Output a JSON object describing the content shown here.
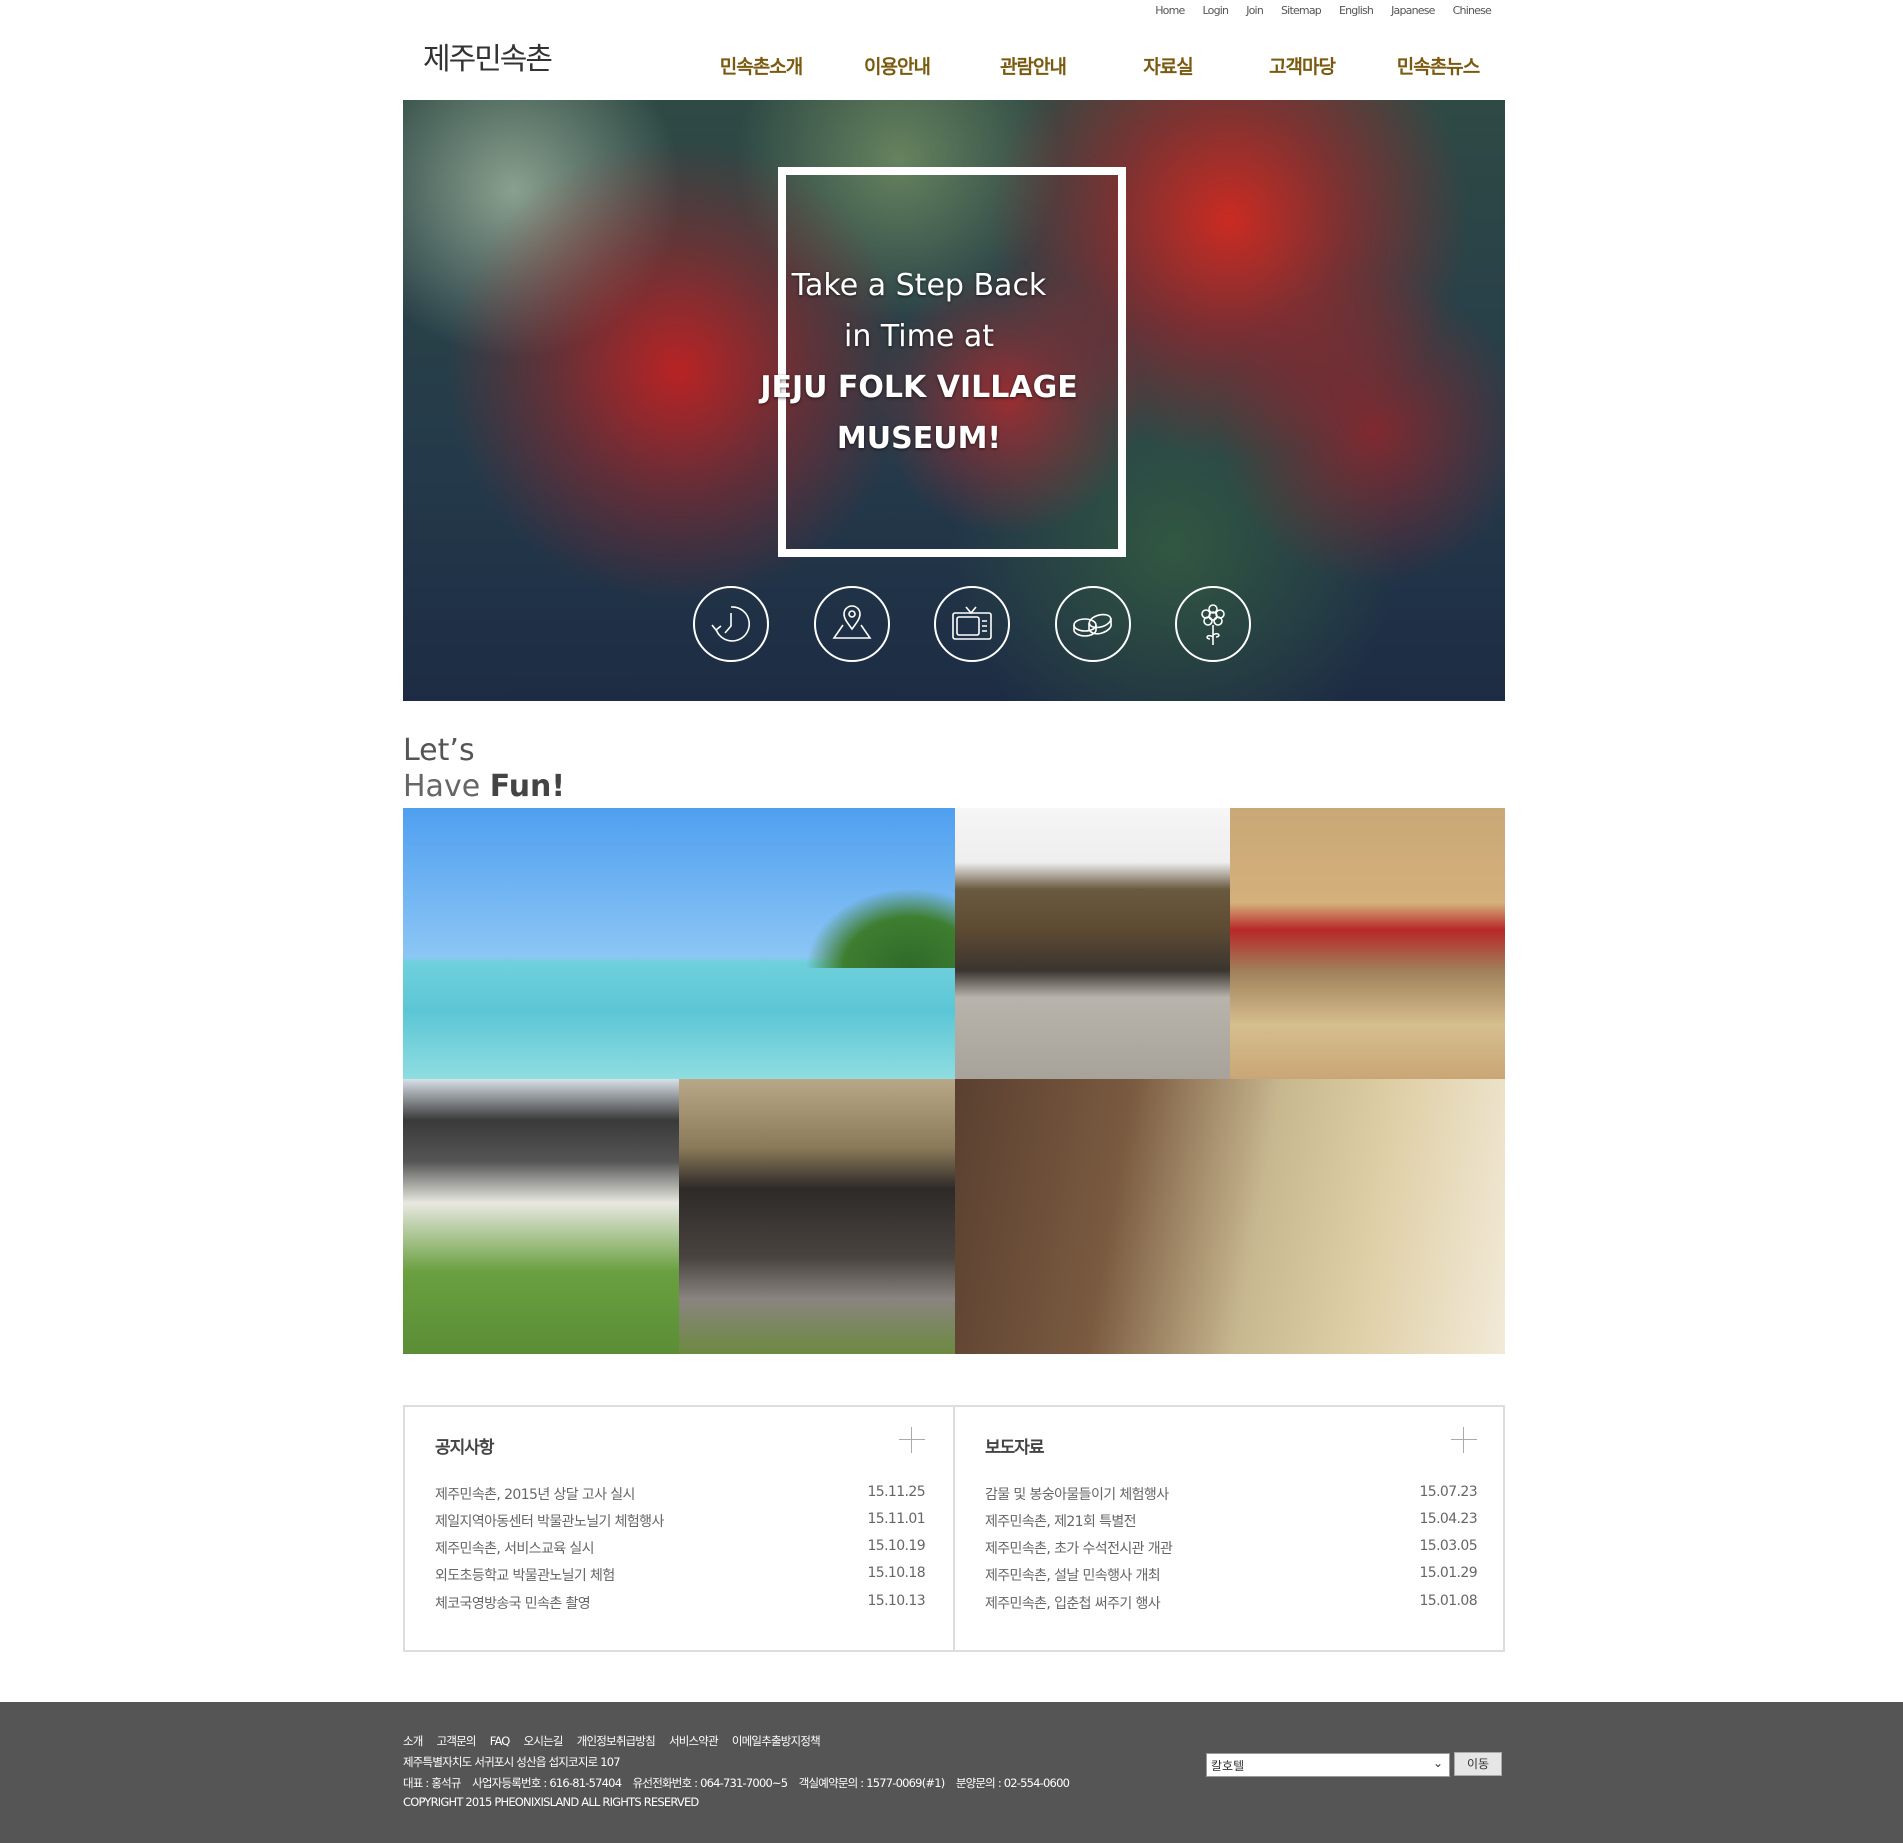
{
  "top_links": [
    "Home",
    "Login",
    "Join",
    "Sitemap",
    "English",
    "Japanese",
    "Chinese"
  ],
  "logo": "제주민속촌",
  "nav": [
    "민속촌소개",
    "이용안내",
    "관람안내",
    "자료실",
    "고객마당",
    "민속촌뉴스"
  ],
  "hero": {
    "lines": [
      "Take a Step Back",
      "in Time at",
      "JEJU FOLK VILLAGE",
      "MUSEUM!"
    ],
    "icons": [
      "clock-history-icon",
      "map-pin-icon",
      "tv-icon",
      "coins-icon",
      "flower-icon"
    ]
  },
  "fun": {
    "line1": "Let’s",
    "line2a": "Have ",
    "line2b": "Fun!"
  },
  "notices": {
    "title": "공지사항",
    "items": [
      {
        "text": "제주민속촌, 2015년 상달 고사 실시",
        "date": "15.11.25"
      },
      {
        "text": "제일지역아동센터 박물관노닐기 체험행사",
        "date": "15.11.01"
      },
      {
        "text": "제주민속촌, 서비스교육 실시",
        "date": "15.10.19"
      },
      {
        "text": "외도초등학교 박물관노닐기 체험",
        "date": "15.10.18"
      },
      {
        "text": "체코국영방송국 민속촌 촬영",
        "date": "15.10.13"
      }
    ]
  },
  "press": {
    "title": "보도자료",
    "items": [
      {
        "text": "감물 및 봉숭아물들이기 체험행사",
        "date": "15.07.23"
      },
      {
        "text": "제주민속촌, 제21회 특별전",
        "date": "15.04.23"
      },
      {
        "text": "제주민속촌, 초가 수석전시관 개관",
        "date": "15.03.05"
      },
      {
        "text": "제주민속촌, 설날 민속행사 개최",
        "date": "15.01.29"
      },
      {
        "text": "제주민속촌, 입춘첩 써주기 행사",
        "date": "15.01.08"
      }
    ]
  },
  "footer": {
    "links": [
      "소개",
      "고객문의",
      "FAQ",
      "오시는길",
      "개인정보취급방침",
      "서비스약관",
      "이메일추출방지정책"
    ],
    "address": "제주특별자치도 서귀포시 성산읍 섭지코지로 107",
    "info": "대표 : 홍석규    사업자등록번호 : 616-81-57404    유선전화번호 : 064-731-7000~5    객실예약문의 : 1577-0069(#1)    분양문의 : 02-554-0600",
    "copyright": "COPYRIGHT 2015 PHEONIXISLAND ALL RIGHTS RESERVED",
    "select_value": "칼호텔",
    "go_label": "이동"
  }
}
